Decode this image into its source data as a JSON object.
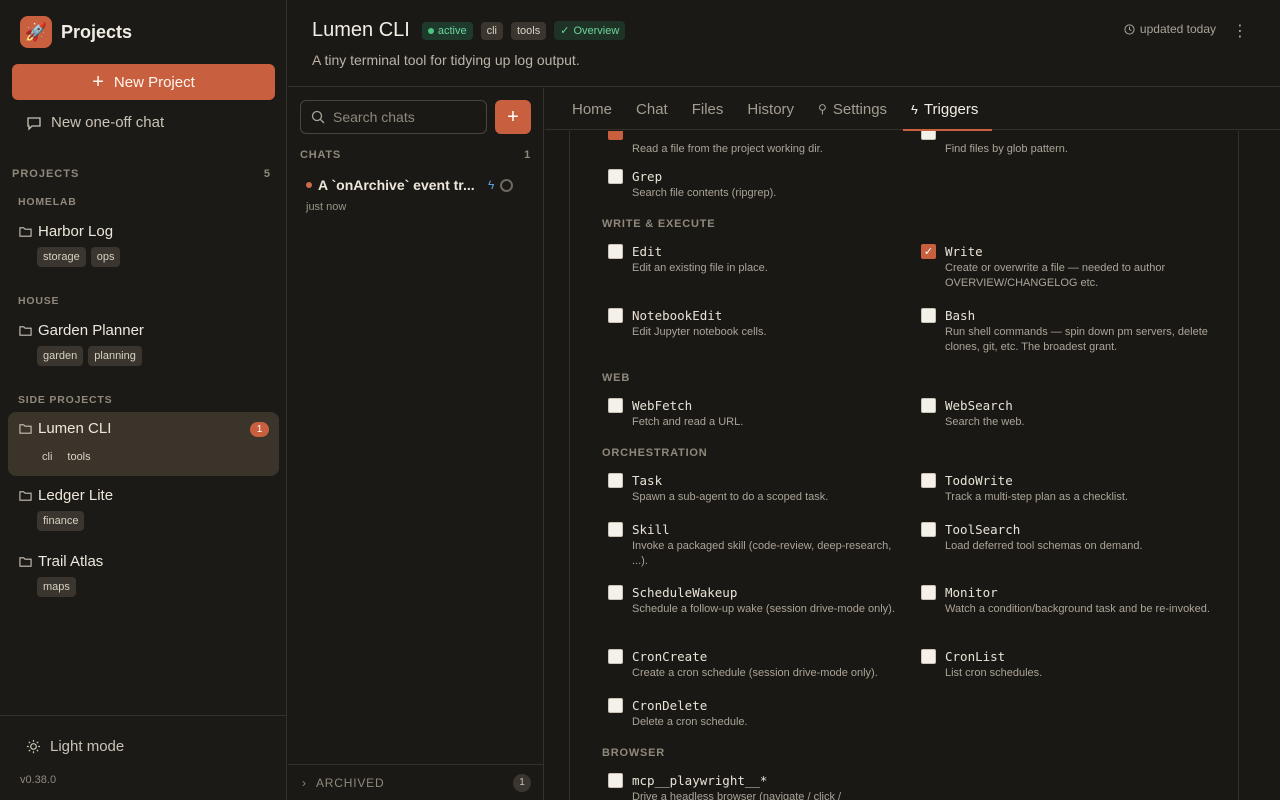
{
  "sidebar": {
    "brand": "Projects",
    "new_project": "New Project",
    "one_off_chat": "New one-off chat",
    "projects_label": "PROJECTS",
    "projects_count": "5",
    "groups": [
      {
        "title": "HOMELAB",
        "projects": [
          {
            "name": "Harbor Log",
            "tags": [
              "storage",
              "ops"
            ]
          }
        ]
      },
      {
        "title": "HOUSE",
        "projects": [
          {
            "name": "Garden Planner",
            "tags": [
              "garden",
              "planning"
            ]
          }
        ]
      },
      {
        "title": "SIDE PROJECTS",
        "projects": [
          {
            "name": "Lumen CLI",
            "tags": [
              "cli",
              "tools"
            ],
            "badge": "1"
          },
          {
            "name": "Ledger Lite",
            "tags": [
              "finance"
            ]
          },
          {
            "name": "Trail Atlas",
            "tags": [
              "maps"
            ]
          }
        ]
      }
    ],
    "light_mode": "Light mode",
    "version": "v0.38.0"
  },
  "header": {
    "title": "Lumen CLI",
    "status": "active",
    "tags": [
      "cli",
      "tools"
    ],
    "overview": "Overview",
    "subtitle": "A tiny terminal tool for tidying up log output.",
    "updated": "updated today"
  },
  "chats": {
    "search_placeholder": "Search chats",
    "heading": "CHATS",
    "count": "1",
    "items": [
      {
        "title": "A `onArchive` event tr...",
        "time": "just now"
      }
    ],
    "archived_label": "ARCHIVED",
    "archived_count": "1"
  },
  "tabs": [
    "Home",
    "Chat",
    "Files",
    "History",
    "Settings",
    "Triggers"
  ],
  "permissions": {
    "top_left_desc": "Read a file from the project working dir.",
    "top_right_desc": "Find files by glob pattern.",
    "grep": {
      "name": "Grep",
      "desc": "Search file contents (ripgrep)."
    },
    "categories": {
      "write": "WRITE & EXECUTE",
      "web": "WEB",
      "orch": "ORCHESTRATION",
      "browser": "BROWSER"
    },
    "edit": {
      "name": "Edit",
      "desc": "Edit an existing file in place."
    },
    "write": {
      "name": "Write",
      "desc": "Create or overwrite a file — needed to author OVERVIEW/CHANGELOG etc."
    },
    "notebook": {
      "name": "NotebookEdit",
      "desc": "Edit Jupyter notebook cells."
    },
    "bash": {
      "name": "Bash",
      "desc": "Run shell commands — spin down pm servers, delete clones, git, etc. The broadest grant."
    },
    "webfetch": {
      "name": "WebFetch",
      "desc": "Fetch and read a URL."
    },
    "websearch": {
      "name": "WebSearch",
      "desc": "Search the web."
    },
    "task": {
      "name": "Task",
      "desc": "Spawn a sub-agent to do a scoped task."
    },
    "todowrite": {
      "name": "TodoWrite",
      "desc": "Track a multi-step plan as a checklist."
    },
    "skill": {
      "name": "Skill",
      "desc": "Invoke a packaged skill (code-review, deep-research, ...)."
    },
    "toolsearch": {
      "name": "ToolSearch",
      "desc": "Load deferred tool schemas on demand."
    },
    "schedule": {
      "name": "ScheduleWakeup",
      "desc": "Schedule a follow-up wake (session drive-mode only)."
    },
    "monitor": {
      "name": "Monitor",
      "desc": "Watch a condition/background task and be re-invoked."
    },
    "croncreate": {
      "name": "CronCreate",
      "desc": "Create a cron schedule (session drive-mode only)."
    },
    "cronlist": {
      "name": "CronList",
      "desc": "List cron schedules."
    },
    "crondelete": {
      "name": "CronDelete",
      "desc": "Delete a cron schedule."
    },
    "playwright": {
      "name": "mcp__playwright__*",
      "desc": "Drive a headless browser (navigate / click /"
    }
  }
}
